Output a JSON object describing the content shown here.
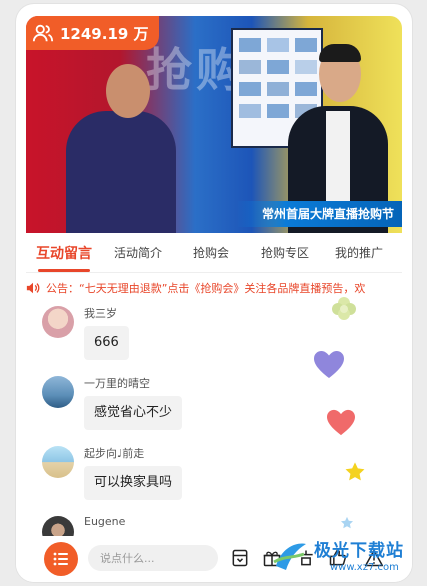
{
  "live": {
    "viewer_count": "1249.19 万",
    "banner_caption": "常州首届大牌直播抢购节"
  },
  "tabs": [
    {
      "label": "互动留言",
      "active": true
    },
    {
      "label": "活动简介",
      "active": false
    },
    {
      "label": "抢购会",
      "active": false
    },
    {
      "label": "抢购专区",
      "active": false
    },
    {
      "label": "我的推广",
      "active": false
    }
  ],
  "notice": {
    "text": "公告：“七天无理由退款”点击《抢购会》关注各品牌直播预告，欢"
  },
  "messages": [
    {
      "user": "我三岁",
      "text": "666",
      "avatar_color": "#d9a0a8"
    },
    {
      "user": "一万里的晴空",
      "text": "感觉省心不少",
      "avatar_color": "#5c8fb8"
    },
    {
      "user": "起步向♩前走",
      "text": "可以换家具吗",
      "avatar_color": "#8ec6e6"
    },
    {
      "user": "Eugene",
      "text": "",
      "avatar_color": "#3a3a3a"
    }
  ],
  "input": {
    "placeholder": "说点什么..."
  },
  "colors": {
    "accent": "#f15d28",
    "tab_active": "#e8462a"
  },
  "watermark": {
    "title": "极光下载站",
    "url": "www.xz7.com"
  }
}
